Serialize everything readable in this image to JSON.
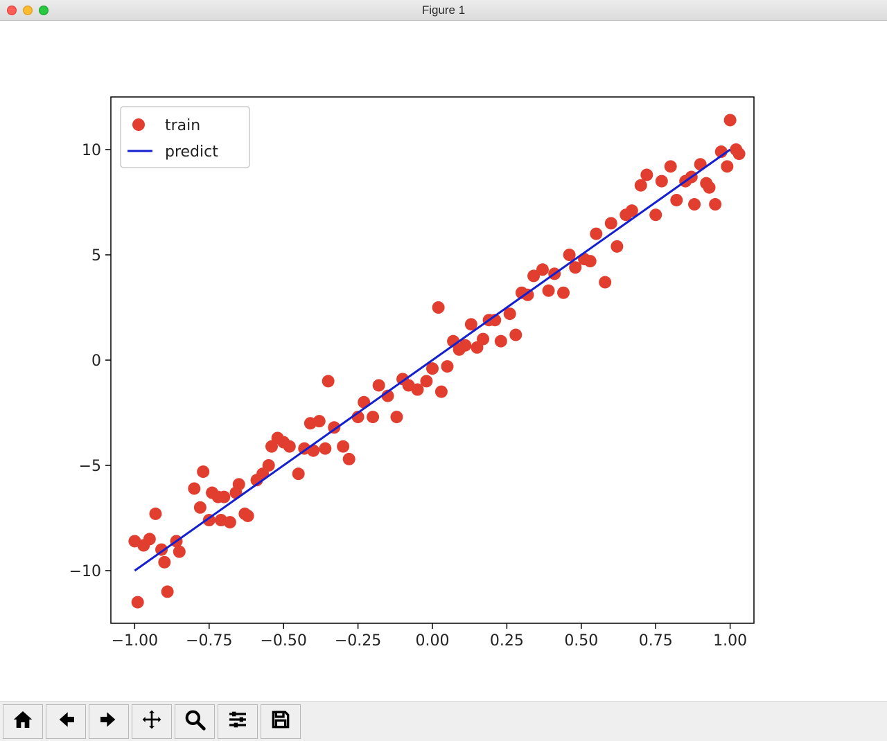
{
  "window": {
    "title": "Figure 1"
  },
  "toolbar": {
    "home": "Home",
    "back": "Back",
    "forward": "Forward",
    "pan": "Pan",
    "zoom": "Zoom",
    "configure": "Configure subplots",
    "save": "Save"
  },
  "legend": {
    "train": "train",
    "predict": "predict"
  },
  "chart_data": {
    "type": "scatter+line",
    "xlabel": "",
    "ylabel": "",
    "title": "",
    "xlim": [
      -1.08,
      1.08
    ],
    "ylim": [
      -12.5,
      12.5
    ],
    "x_ticks": [
      -1.0,
      -0.75,
      -0.5,
      -0.25,
      0.0,
      0.25,
      0.5,
      0.75,
      1.0
    ],
    "y_ticks": [
      -10,
      -5,
      0,
      5,
      10
    ],
    "series": [
      {
        "name": "train",
        "kind": "scatter",
        "color": "#e23e30",
        "x": [
          -1.0,
          -0.99,
          -0.97,
          -0.95,
          -0.93,
          -0.91,
          -0.9,
          -0.89,
          -0.86,
          -0.85,
          -0.8,
          -0.78,
          -0.77,
          -0.75,
          -0.74,
          -0.72,
          -0.71,
          -0.7,
          -0.68,
          -0.66,
          -0.65,
          -0.63,
          -0.62,
          -0.59,
          -0.57,
          -0.55,
          -0.54,
          -0.52,
          -0.5,
          -0.48,
          -0.45,
          -0.43,
          -0.41,
          -0.4,
          -0.38,
          -0.36,
          -0.35,
          -0.33,
          -0.3,
          -0.28,
          -0.25,
          -0.23,
          -0.2,
          -0.18,
          -0.15,
          -0.12,
          -0.1,
          -0.08,
          -0.05,
          -0.02,
          0.0,
          0.02,
          0.03,
          0.05,
          0.07,
          0.09,
          0.11,
          0.13,
          0.15,
          0.17,
          0.19,
          0.21,
          0.23,
          0.26,
          0.28,
          0.3,
          0.32,
          0.34,
          0.37,
          0.39,
          0.41,
          0.44,
          0.46,
          0.48,
          0.51,
          0.53,
          0.55,
          0.58,
          0.6,
          0.62,
          0.65,
          0.67,
          0.7,
          0.72,
          0.75,
          0.77,
          0.8,
          0.82,
          0.85,
          0.87,
          0.88,
          0.9,
          0.92,
          0.93,
          0.95,
          0.97,
          0.99,
          1.0,
          1.02,
          1.03
        ],
        "y": [
          -8.6,
          -11.5,
          -8.8,
          -8.5,
          -7.3,
          -9.0,
          -9.6,
          -11.0,
          -8.6,
          -9.1,
          -6.1,
          -7.0,
          -5.3,
          -7.6,
          -6.3,
          -6.5,
          -7.6,
          -6.5,
          -7.7,
          -6.3,
          -5.9,
          -7.3,
          -7.4,
          -5.7,
          -5.4,
          -5.0,
          -4.1,
          -3.7,
          -3.9,
          -4.1,
          -5.4,
          -4.2,
          -3.0,
          -4.3,
          -2.9,
          -4.2,
          -1.0,
          -3.2,
          -4.1,
          -4.7,
          -2.7,
          -2.0,
          -2.7,
          -1.2,
          -1.7,
          -2.7,
          -0.9,
          -1.2,
          -1.4,
          -1.0,
          -0.4,
          2.5,
          -1.5,
          -0.3,
          0.9,
          0.5,
          0.7,
          1.7,
          0.6,
          1.0,
          1.9,
          1.9,
          0.9,
          2.2,
          1.2,
          3.2,
          3.1,
          4.0,
          4.3,
          3.3,
          4.1,
          3.2,
          5.0,
          4.4,
          4.8,
          4.7,
          6.0,
          3.7,
          6.5,
          5.4,
          6.9,
          7.1,
          8.3,
          8.8,
          6.9,
          8.5,
          9.2,
          7.6,
          8.5,
          8.7,
          7.4,
          9.3,
          8.4,
          8.2,
          7.4,
          9.9,
          9.2,
          11.4,
          10.0,
          9.8
        ]
      },
      {
        "name": "predict",
        "kind": "line",
        "color": "#1420d0",
        "x": [
          -1.0,
          1.0
        ],
        "y": [
          -10.0,
          10.0
        ]
      }
    ]
  }
}
